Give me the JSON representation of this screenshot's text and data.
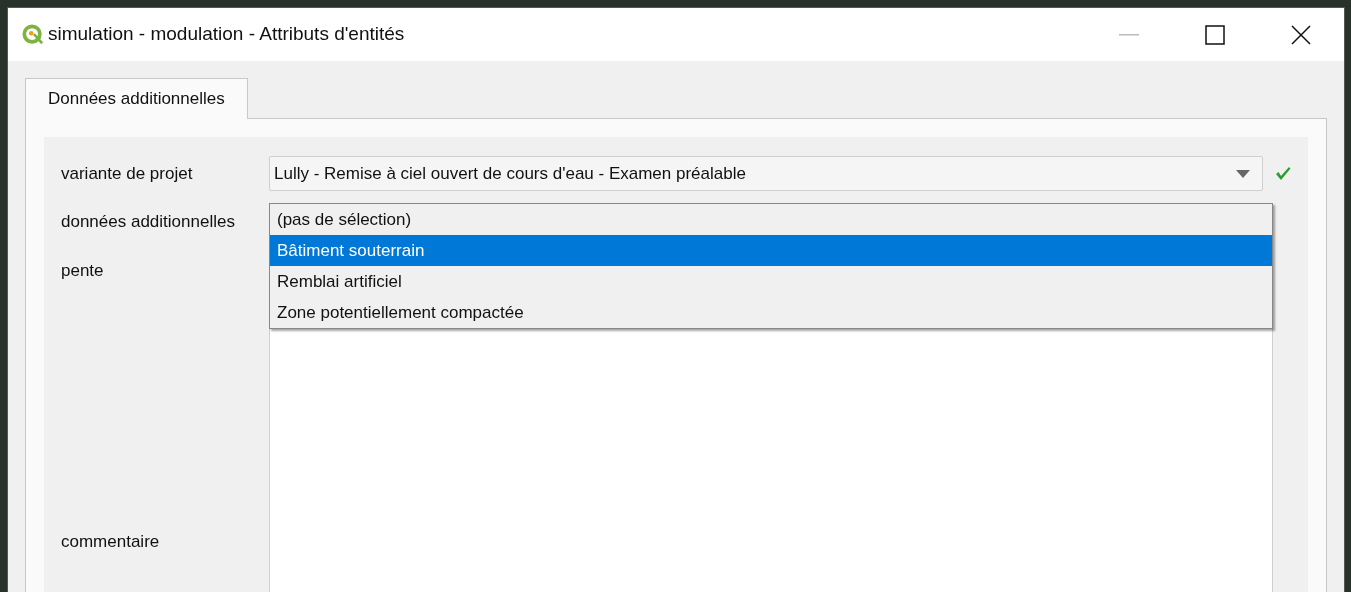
{
  "window": {
    "title": "simulation - modulation - Attributs d'entités"
  },
  "tabs": [
    {
      "label": "Données additionnelles",
      "selected": true
    }
  ],
  "labels": [
    "variante de projet",
    "données additionnelles",
    "pente",
    "commentaire"
  ],
  "project_variant": {
    "value": "Lully - Remise à ciel ouvert de cours d'eau - Examen préalable",
    "valid": true
  },
  "dropdown": {
    "options": [
      {
        "label": "(pas de sélection)",
        "selected": false
      },
      {
        "label": "Bâtiment souterrain",
        "selected": true
      },
      {
        "label": "Remblai artificiel",
        "selected": false
      },
      {
        "label": "Zone potentiellement compactée",
        "selected": false
      }
    ]
  }
}
